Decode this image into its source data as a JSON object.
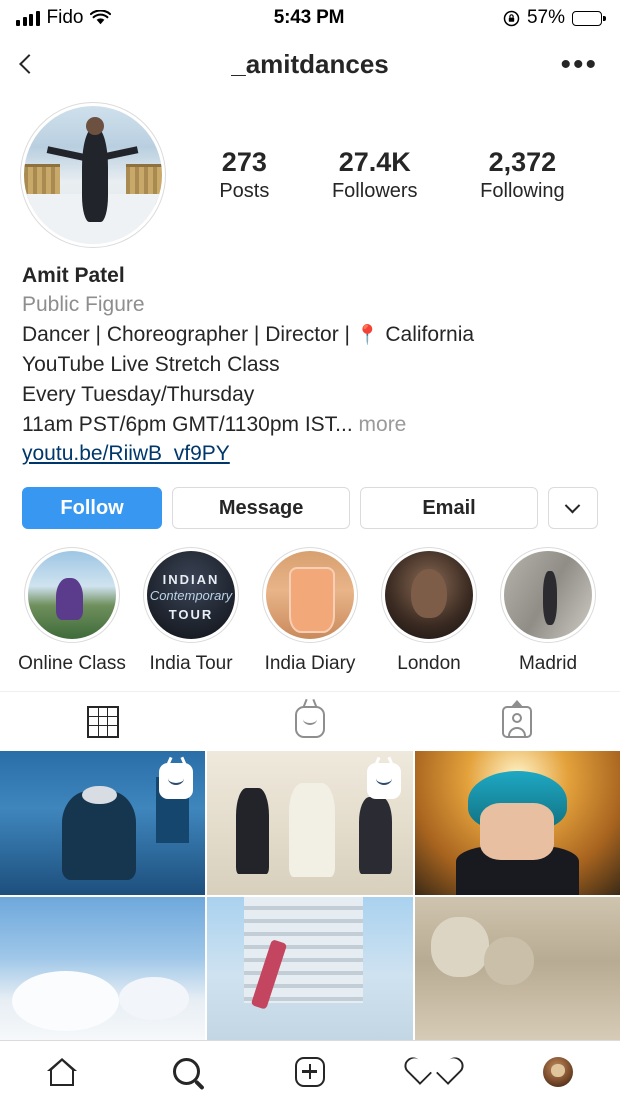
{
  "status_bar": {
    "carrier": "Fido",
    "time": "5:43 PM",
    "battery_percent": "57%",
    "signal_icon": "signal-bars-icon",
    "wifi_icon": "wifi-icon",
    "rotation_lock_icon": "rotation-lock-icon",
    "battery_icon": "battery-icon",
    "battery_fill_pct": 60
  },
  "nav": {
    "back_icon": "back-chevron-icon",
    "title": "_amitdances",
    "more_icon": "more-options-icon",
    "more_label": "•••"
  },
  "profile": {
    "avatar_icon": "profile-avatar",
    "stats": [
      {
        "value": "273",
        "label": "Posts"
      },
      {
        "value": "27.4K",
        "label": "Followers"
      },
      {
        "value": "2,372",
        "label": "Following"
      }
    ],
    "display_name": "Amit Patel",
    "category": "Public Figure",
    "bio_lines": [
      "Dancer | Choreographer | Director |",
      "YouTube Live Stretch Class",
      "Every Tuesday/Thursday",
      "11am PST/6pm GMT/1130pm IST..."
    ],
    "location_pin_icon": "location-pin-icon",
    "location_pin": "📍",
    "location": "California",
    "more_label": "more",
    "link": "youtu.be/RiiwB_vf9PY"
  },
  "actions": {
    "follow_label": "Follow",
    "message_label": "Message",
    "email_label": "Email",
    "dropdown_icon": "chevron-down-icon"
  },
  "highlights": [
    {
      "label": "Online Class",
      "icon": "highlight-online-class"
    },
    {
      "label": "India Tour",
      "icon": "highlight-india-tour",
      "poster_top": "INDIAN",
      "poster_mid": "Contemporary",
      "poster_bottom": "TOUR"
    },
    {
      "label": "India Diary",
      "icon": "highlight-india-diary"
    },
    {
      "label": "London",
      "icon": "highlight-london"
    },
    {
      "label": "Madrid",
      "icon": "highlight-madrid"
    }
  ],
  "tabs": [
    {
      "name": "grid-tab",
      "icon": "grid-icon",
      "active": true
    },
    {
      "name": "igtv-tab",
      "icon": "igtv-icon",
      "active": false
    },
    {
      "name": "tagged-tab",
      "icon": "tagged-person-icon",
      "active": false
    }
  ],
  "posts": [
    {
      "icon": "post-thumbnail-1",
      "badge": "igtv-badge-icon"
    },
    {
      "icon": "post-thumbnail-2",
      "badge": "igtv-badge-icon"
    },
    {
      "icon": "post-thumbnail-3",
      "badge": null
    },
    {
      "icon": "post-thumbnail-4",
      "badge": null
    },
    {
      "icon": "post-thumbnail-5",
      "badge": null
    },
    {
      "icon": "post-thumbnail-6",
      "badge": null
    }
  ],
  "bottom_nav": [
    {
      "name": "home-tab",
      "icon": "home-icon"
    },
    {
      "name": "search-tab",
      "icon": "search-icon"
    },
    {
      "name": "create-tab",
      "icon": "plus-square-icon"
    },
    {
      "name": "activity-tab",
      "icon": "heart-icon"
    },
    {
      "name": "profile-tab",
      "icon": "profile-avatar-icon"
    }
  ],
  "colors": {
    "accent_blue": "#3897f0",
    "link_blue": "#00376b",
    "text_primary": "#262626",
    "text_secondary": "#8e8e8e",
    "border": "#dbdbdb"
  }
}
